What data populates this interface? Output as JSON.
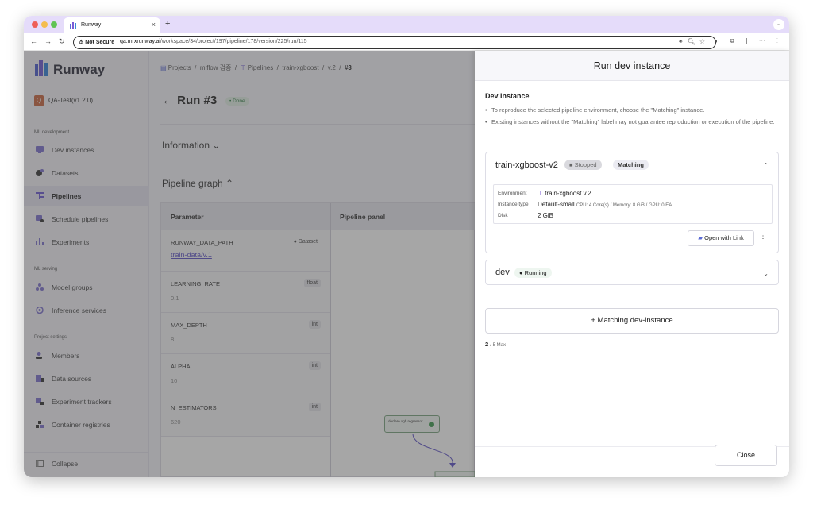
{
  "browser": {
    "tab_title": "Runway",
    "tab_close": "×",
    "new_tab": "+",
    "security": "⚠ Not Secure",
    "url_host": "qa.mrxrunway.ai",
    "url_path": "/workspace/34/project/197/pipeline/178/version/225/run/115"
  },
  "app": {
    "brand": "Runway",
    "project": "QA-Test(v1.2.0)",
    "project_initial": "Q"
  },
  "sidebar": {
    "sections": [
      {
        "label": "ML development",
        "items": [
          {
            "label": "Dev instances",
            "icon": "dev-instances-icon"
          },
          {
            "label": "Datasets",
            "icon": "datasets-icon"
          },
          {
            "label": "Pipelines",
            "icon": "pipelines-icon",
            "active": true
          },
          {
            "label": "Schedule pipelines",
            "icon": "schedule-icon"
          },
          {
            "label": "Experiments",
            "icon": "experiments-icon"
          }
        ]
      },
      {
        "label": "ML serving",
        "items": [
          {
            "label": "Model groups",
            "icon": "model-groups-icon"
          },
          {
            "label": "Inference services",
            "icon": "inference-icon"
          }
        ]
      },
      {
        "label": "Project settings",
        "items": [
          {
            "label": "Members",
            "icon": "members-icon"
          },
          {
            "label": "Data sources",
            "icon": "data-sources-icon"
          },
          {
            "label": "Experiment trackers",
            "icon": "trackers-icon"
          },
          {
            "label": "Container registries",
            "icon": "registries-icon"
          }
        ]
      }
    ],
    "collapse": "Collapse"
  },
  "main": {
    "breadcrumb": [
      "Projects",
      "mlflow 검증",
      "Pipelines",
      "train-xgboost",
      "v.2",
      "#3"
    ],
    "run_title": "← Run #3",
    "run_status": "• Done",
    "information": "Information ⌄",
    "pipeline_graph": "Pipeline graph ⌃",
    "table": {
      "col_parameter": "Parameter",
      "col_panel": "Pipeline panel",
      "rows": [
        {
          "name": "RUNWAY_DATA_PATH",
          "type": "Dataset",
          "value": "train-data/v.1"
        },
        {
          "name": "LEARNING_RATE",
          "type": "float",
          "value": "0.1"
        },
        {
          "name": "MAX_DEPTH",
          "type": "int",
          "value": "8"
        },
        {
          "name": "ALPHA",
          "type": "int",
          "value": "10"
        },
        {
          "name": "N_ESTIMATORS",
          "type": "int",
          "value": "620"
        }
      ]
    },
    "node_label": "declare xgb regressor"
  },
  "drawer": {
    "title": "Run dev instance",
    "subtitle": "Dev instance",
    "bullets": [
      "To reproduce the selected pipeline environment, choose the \"Matching\" instance.",
      "Existing instances without the \"Matching\" label may not guarantee reproduction or execution of the pipeline."
    ],
    "instances": [
      {
        "name": "train-xgboost-v2",
        "status": "■ Stopped",
        "matching": "Matching",
        "env_label": "Environment",
        "env_value": "train-xgboost v.2",
        "type_label": "Instance type",
        "type_value": "Default-small",
        "type_spec": "CPU: 4 Core(s) / Memory: 8 GiB / GPU: 0 EA",
        "disk_label": "Disk",
        "disk_value": "2 GiB",
        "open_link": "Open with Link",
        "more": "⋮",
        "chevron": "⌃"
      },
      {
        "name": "dev",
        "status": "● Running",
        "chevron": "⌄"
      }
    ],
    "add_matching": "+ Matching dev-instance",
    "count": "2",
    "count_max": "/ 5 Max",
    "close": "Close"
  }
}
